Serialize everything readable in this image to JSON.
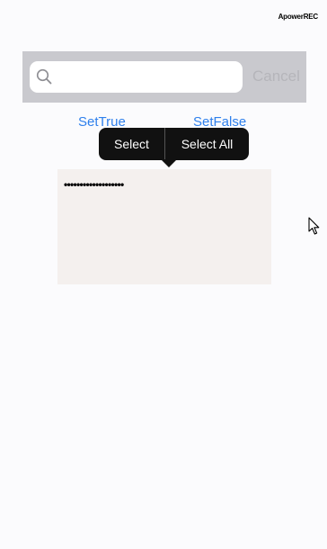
{
  "watermark": {
    "text": "ApowerREC"
  },
  "search": {
    "placeholder": "",
    "value": "",
    "cancel_label": "Cancel",
    "icon": "search-icon"
  },
  "buttons": {
    "set_true": "SetTrue",
    "set_false": "SetFalse"
  },
  "edit_menu": {
    "items": [
      "Select",
      "Select All"
    ]
  },
  "text_area": {
    "value": "•••••••••••••••••••"
  },
  "colors": {
    "background": "#fbfbfd",
    "search_bar": "#c9c9ce",
    "link": "#2f80ec",
    "cancel": "#b5b5ba",
    "menu": "#111111",
    "text_area": "#f4f0ee"
  },
  "cursor": {
    "icon": "mouse-pointer-icon"
  }
}
